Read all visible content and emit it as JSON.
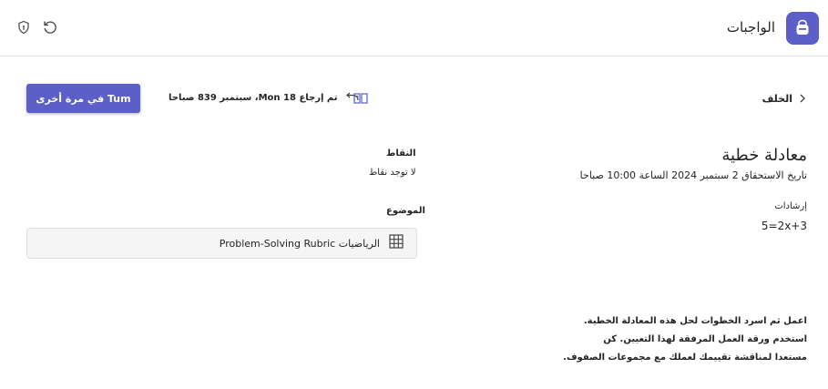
{
  "header": {
    "app_title": "الواجبات",
    "app_icon": "backpack-icon",
    "actions": [
      {
        "name": "shield-icon"
      },
      {
        "name": "refresh-icon"
      }
    ]
  },
  "toolbar": {
    "back_label": "الخلف",
    "returned_text": "تم إرجاع 18 Mon، سبتمبر 839 صباحا",
    "turn_in_label": "Tum في مرة أخرى"
  },
  "assignment": {
    "title": "معادلة خطية",
    "due_date": "تاريخ الاستحقاق 2 سبتمبر 2024 الساعة 10:00 صباحا",
    "instructions_label": "إرشادات",
    "equation": "5=2x+3",
    "body_lines": [
      "اعمل ثم اسرد الخطوات لحل هذه المعادلة الخطية.",
      "استخدم ورقة العمل المرفقة لهذا التعيين. كن",
      "مستعدا لمناقشة تقييمك لعملك مع مجموعات الصفوف."
    ]
  },
  "points": {
    "label": "النقاط",
    "value": "لا توجد نقاط"
  },
  "rubric": {
    "label": "الموضوع",
    "item": "الرياضيات Problem-Solving Rubric"
  },
  "colors": {
    "accent": "#5b5fc7",
    "text": "#242424",
    "card_bg": "#f5f5f5"
  }
}
